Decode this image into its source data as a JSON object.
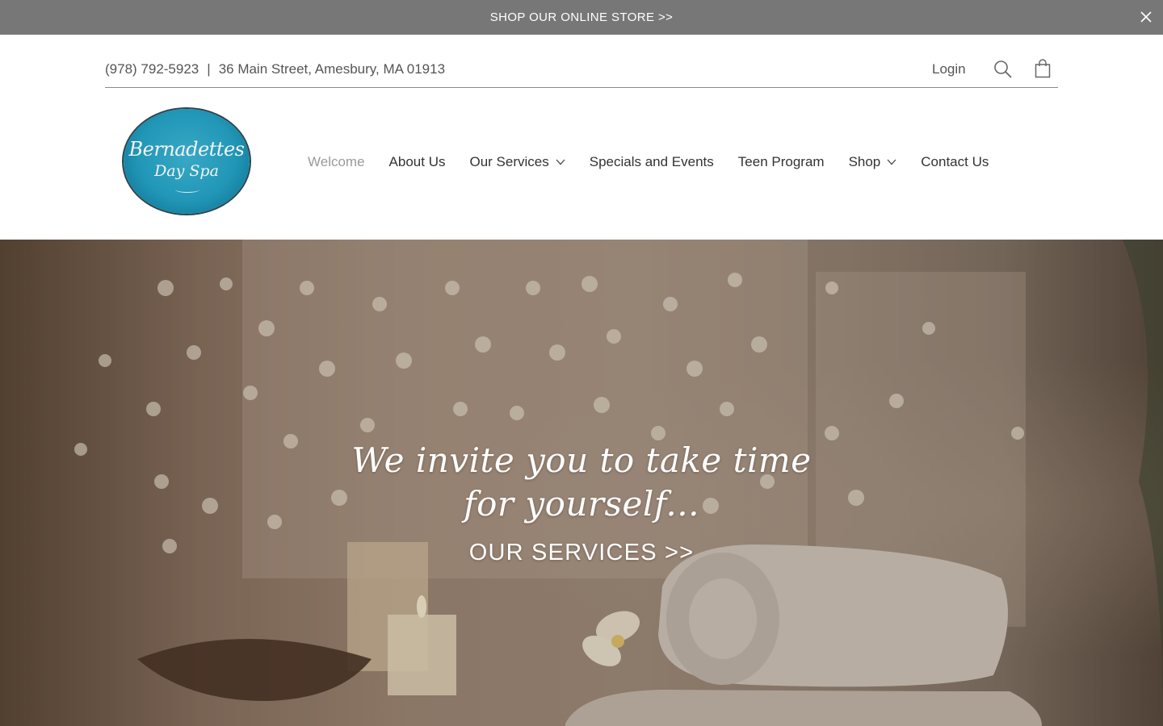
{
  "announcement": {
    "text": "SHOP OUR ONLINE STORE >>",
    "close_icon": "close-icon"
  },
  "topbar": {
    "phone": "(978) 792-5923",
    "separator": "|",
    "address": "36 Main Street, Amesbury, MA 01913",
    "login": "Login",
    "search_icon": "search-icon",
    "cart_icon": "shopping-bag-icon"
  },
  "logo": {
    "line1": "Bernadettes",
    "line2": "Day Spa",
    "color": "#2196b6"
  },
  "nav": {
    "items": [
      {
        "label": "Welcome",
        "active": true
      },
      {
        "label": "About Us"
      },
      {
        "label": "Our Services",
        "dropdown": true
      },
      {
        "label": "Specials and Events"
      },
      {
        "label": "Teen Program"
      },
      {
        "label": "Shop",
        "dropdown": true
      },
      {
        "label": "Contact Us"
      }
    ]
  },
  "hero": {
    "headline": "We invite you to take time for yourself...",
    "cta": "OUR SERVICES >>"
  },
  "colors": {
    "announcement_bg": "#777777",
    "text": "#333333",
    "active_nav": "#9a9a9a"
  }
}
